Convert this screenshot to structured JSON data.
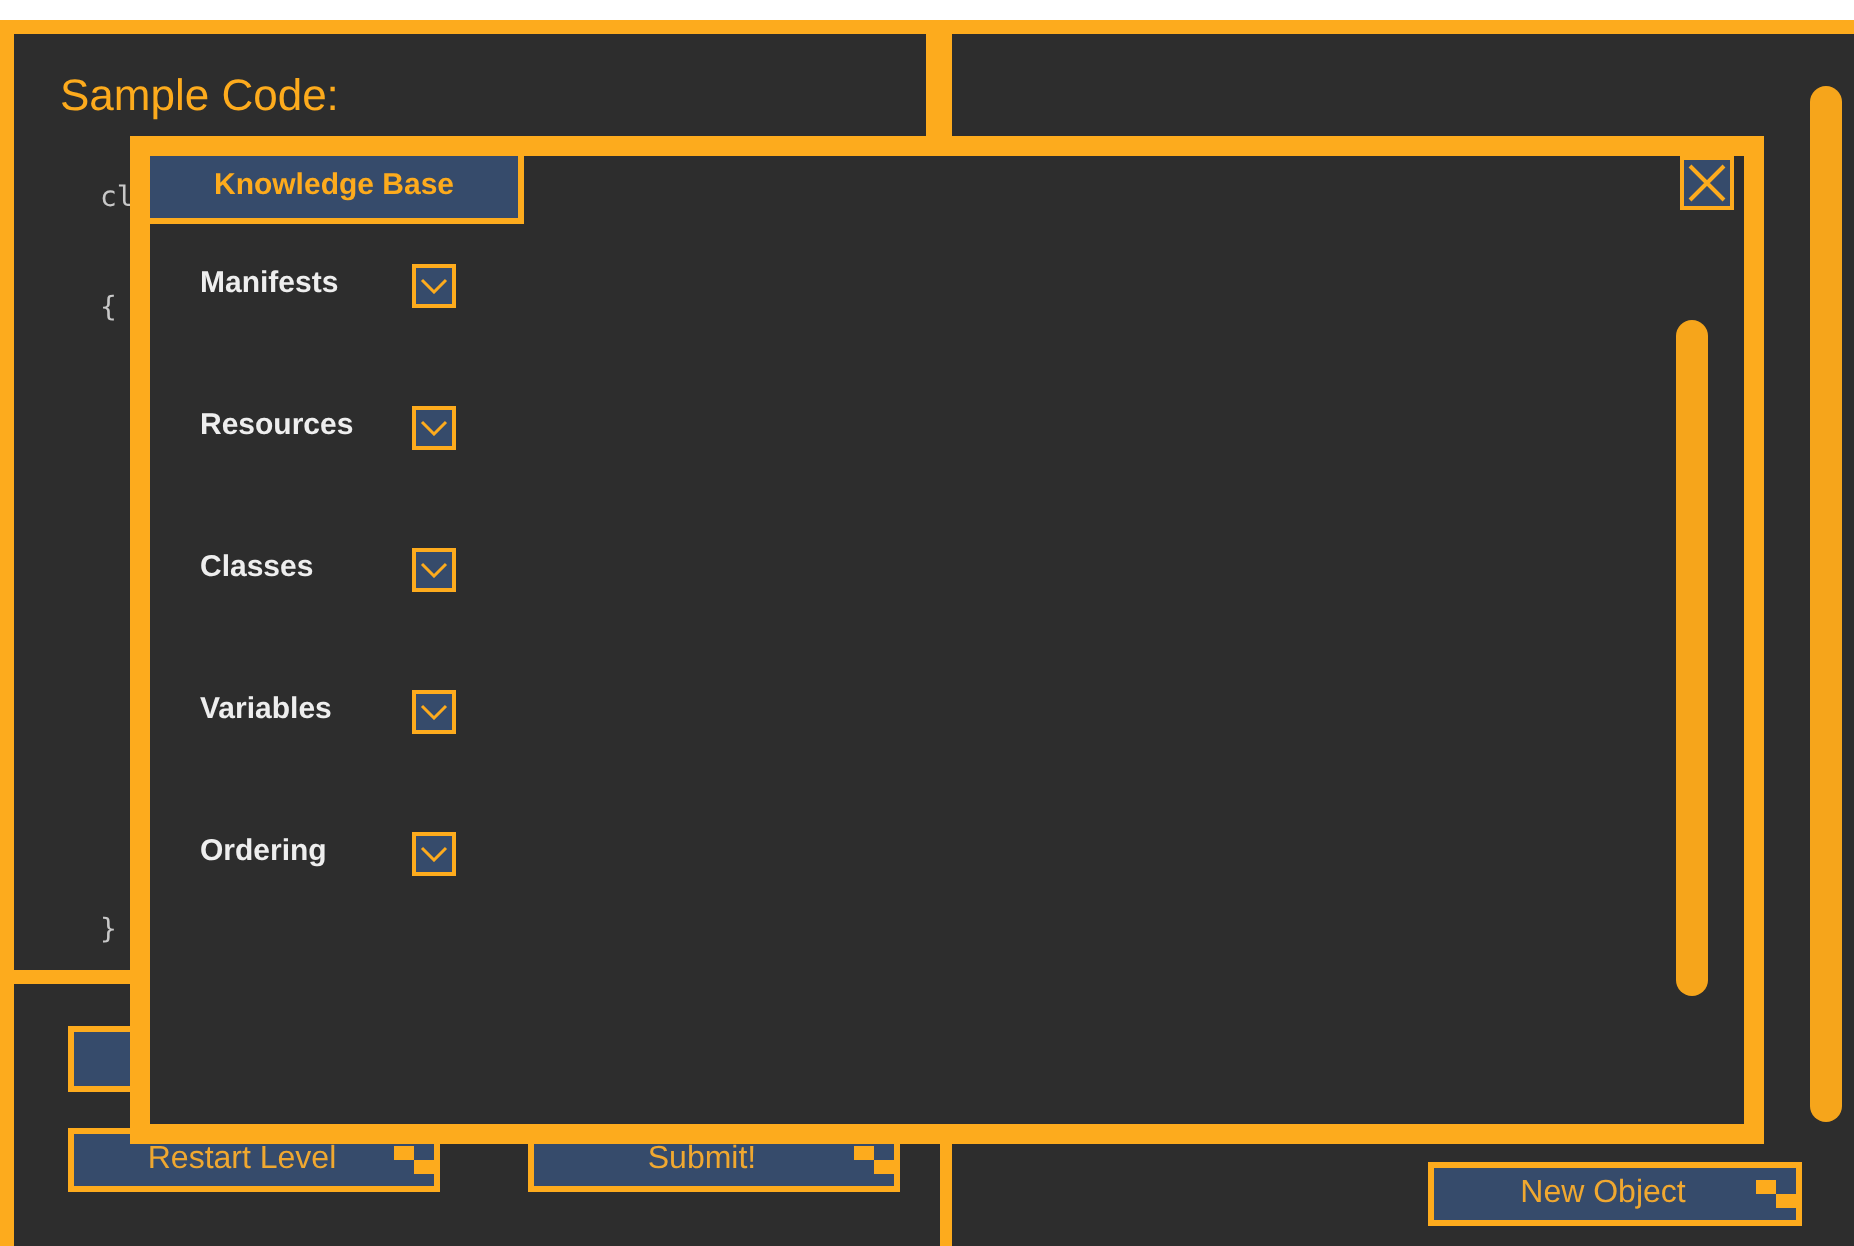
{
  "code_panel": {
    "title": "Sample Code:",
    "code_lines": [
      "cl",
      "{",
      "}"
    ]
  },
  "knowledge_base": {
    "tab": {
      "label": "Knowledge Base",
      "selected": true
    },
    "items": [
      {
        "label": "Manifests",
        "expanded": false
      },
      {
        "label": "Resources",
        "expanded": false
      },
      {
        "label": "Classes",
        "expanded": false
      },
      {
        "label": "Variables",
        "expanded": false
      },
      {
        "label": "Ordering",
        "expanded": false
      }
    ]
  },
  "buttons": [
    {
      "label": "Restart Level"
    },
    {
      "label": "Submit!"
    },
    {
      "label": "New Object"
    }
  ]
}
